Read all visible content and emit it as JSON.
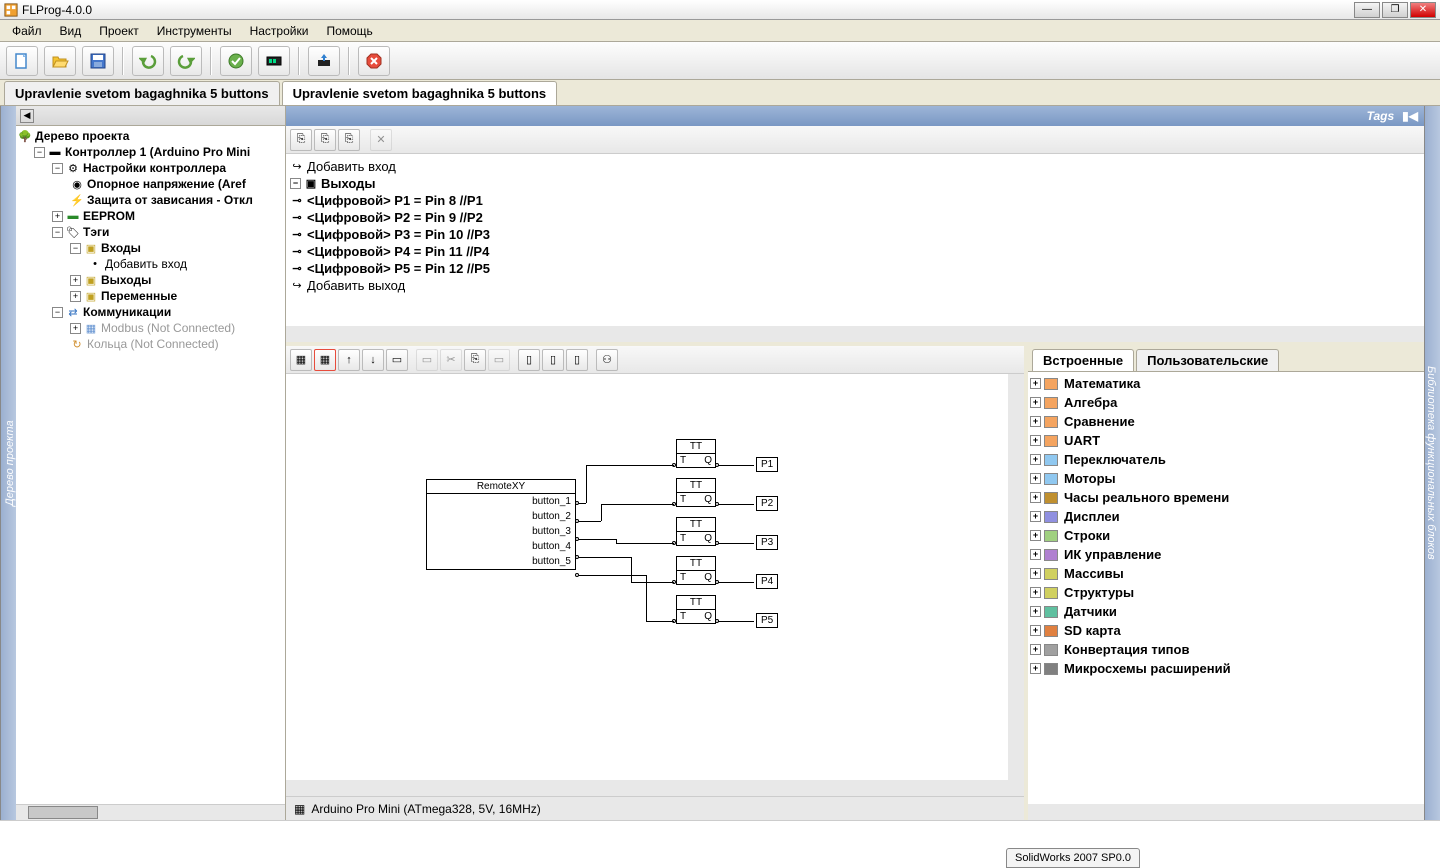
{
  "app": {
    "title": "FLProg-4.0.0"
  },
  "menu": {
    "file": "Файл",
    "view": "Вид",
    "project": "Проект",
    "tools": "Инструменты",
    "settings": "Настройки",
    "help": "Помощь"
  },
  "doc_tabs": [
    {
      "label": "Upravlenie svetom bagaghnika 5 buttons",
      "active": false
    },
    {
      "label": "Upravlenie svetom bagaghnika 5 buttons",
      "active": true
    }
  ],
  "left_collapsed_tab": "Дерево проекта",
  "right_collapsed_tab": "Библиотека функциональных блоков",
  "tree": {
    "root": "Дерево проекта",
    "controller": "Контроллер 1 (Arduino Pro Mini",
    "settings": "Настройки контроллера",
    "aref": "Опорное напряжение (Aref",
    "watchdog": "Защита от зависания - Откл",
    "eeprom": "EEPROM",
    "tags": "Тэги",
    "inputs": "Входы",
    "add_input": "Добавить вход",
    "outputs": "Выходы",
    "variables": "Переменные",
    "comm": "Коммуникации",
    "modbus": "Modbus (Not Connected)",
    "rings": "Кольца (Not Connected)"
  },
  "center_top": {
    "tags_label": "Tags",
    "add_input": "Добавить вход",
    "outputs_label": "Выходы",
    "outs": [
      "<Цифровой> P1 = Pin 8  //P1",
      "<Цифровой> P2 = Pin 9  //P2",
      "<Цифровой> P3 = Pin 10  //P3",
      "<Цифровой> P4 = Pin 11  //P4",
      "<Цифровой> P5 = Pin 12  //P5"
    ],
    "add_output": "Добавить выход"
  },
  "canvas": {
    "remotexy": "RemoteXY",
    "buttons": [
      "button_1",
      "button_2",
      "button_3",
      "button_4",
      "button_5"
    ],
    "tt_title": "TT",
    "port_t": "T",
    "port_q": "Q",
    "outputs": [
      "P1",
      "P2",
      "P3",
      "P4",
      "P5"
    ],
    "status": "Arduino Pro Mini (ATmega328, 5V, 16MHz)"
  },
  "lib": {
    "tabs": {
      "builtin": "Встроенные",
      "user": "Пользовательские"
    },
    "items": [
      "Математика",
      "Алгебра",
      "Сравнение",
      "UART",
      "Переключатель",
      "Моторы",
      "Часы реального времени",
      "Дисплеи",
      "Строки",
      "ИК управление",
      "Массивы",
      "Структуры",
      "Датчики",
      "SD карта",
      "Конвертация типов",
      "Микросхемы расширений"
    ]
  },
  "footer": {
    "solidworks": "SolidWorks 2007 SP0.0"
  }
}
